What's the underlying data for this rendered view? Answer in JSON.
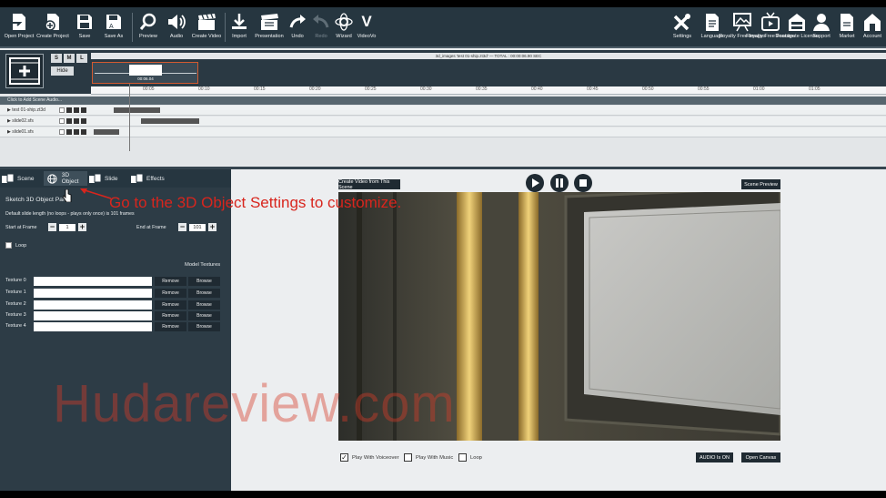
{
  "toolbar": {
    "left": [
      {
        "label": "Open Project",
        "icon": "open-project-icon"
      },
      {
        "label": "Create Project",
        "icon": "create-project-icon"
      },
      {
        "label": "Save",
        "icon": "save-icon"
      },
      {
        "label": "Save As",
        "icon": "save-as-icon"
      },
      {
        "label": "Preview",
        "icon": "preview-icon"
      },
      {
        "label": "Audio",
        "icon": "audio-icon"
      },
      {
        "label": "Create Video",
        "icon": "create-video-icon"
      },
      {
        "label": "Import",
        "icon": "import-icon"
      },
      {
        "label": "Presentation",
        "icon": "presentation-icon"
      },
      {
        "label": "Undo",
        "icon": "undo-icon"
      },
      {
        "label": "Redo",
        "icon": "redo-icon"
      },
      {
        "label": "Wizard",
        "icon": "wizard-icon"
      },
      {
        "label": "VideoVo",
        "icon": "videovo-icon"
      }
    ],
    "right": [
      {
        "label": "Settings",
        "icon": "settings-icon"
      },
      {
        "label": "Language",
        "icon": "language-icon"
      },
      {
        "label": "Royalty Free Images",
        "icon": "royalty-free-images-icon"
      },
      {
        "label": "Royalty Free Footage",
        "icon": "royalty-free-footage-icon"
      },
      {
        "label": "Deactivate License",
        "icon": "deactivate-license-icon"
      },
      {
        "label": "Support",
        "icon": "support-icon"
      },
      {
        "label": "Market",
        "icon": "market-icon"
      },
      {
        "label": "Account",
        "icon": "account-icon"
      }
    ]
  },
  "timeline": {
    "size_buttons": [
      "S",
      "M",
      "L"
    ],
    "hide_label": "Hide",
    "scene_strip_text": "3d_images 'test 01-ship.zt3d' — TOTAL : 00:00:06.90 SEC",
    "scene_time": "00:06.04",
    "ruler_ticks": [
      "00:05",
      "00:10",
      "00:15",
      "00:20",
      "00:25",
      "00:30",
      "00:35",
      "00:40",
      "00:45",
      "00:50",
      "00:55",
      "01:00",
      "01:05"
    ],
    "add_scene_label": "Click to Add Scene Audio...",
    "tracks": [
      {
        "name": "test 01-ship.zt3d"
      },
      {
        "name": "slide02.sfs"
      },
      {
        "name": "slide01.sfs"
      }
    ]
  },
  "left_panel": {
    "tabs": [
      {
        "label": "Scene"
      },
      {
        "label": "3D Object"
      },
      {
        "label": "Slide"
      },
      {
        "label": "Effects"
      }
    ],
    "panel_title": "Sketch 3D Object Panel",
    "description": "Default slide length (no loops - plays only once) is 101 frames",
    "start_label": "Start at Frame",
    "start_value": "1",
    "end_label": "End at Frame",
    "end_value": "101",
    "loop_label": "Loop",
    "model_textures_heading": "Model Textures",
    "remove_label": "Remove",
    "browse_label": "Browse",
    "textures": [
      "Texture 0",
      "Texture 1",
      "Texture 2",
      "Texture 3",
      "Texture 4"
    ]
  },
  "preview": {
    "create_video_label": "Create Video from This Scene",
    "scene_preview_label": "Scene Preview",
    "options": [
      {
        "label": "Play With Voiceover",
        "checked": true
      },
      {
        "label": "Play With Music",
        "checked": false
      },
      {
        "label": "Loop",
        "checked": false
      }
    ],
    "audio_label": "AUDIO Is ON",
    "open_canvas_label": "Open Canvas"
  },
  "annotation": "Go to the 3D Object Settings to customize.",
  "watermark": "Hudareview.com",
  "colors": {
    "toolbar_bg": "#263640",
    "panel_bg": "#2d3c46",
    "annotation": "#d8251d"
  }
}
